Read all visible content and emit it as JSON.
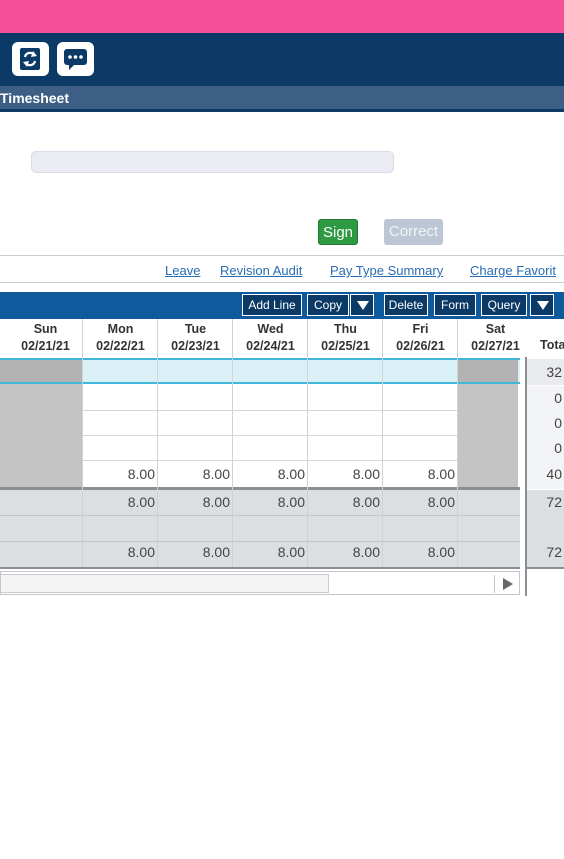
{
  "header": {
    "title": "Timesheet",
    "icons": [
      "refresh-icon",
      "chat-icon"
    ]
  },
  "actions": {
    "sign": "Sign",
    "correct": "Correct"
  },
  "links": [
    "Leave",
    "Revision Audit",
    "Pay Type Summary",
    "Charge Favorit"
  ],
  "toolbar": {
    "add_line": "Add Line",
    "copy": "Copy",
    "delete": "Delete",
    "form": "Form",
    "query": "Query"
  },
  "grid": {
    "days": [
      {
        "day": "Sun",
        "date": "02/21/21"
      },
      {
        "day": "Mon",
        "date": "02/22/21"
      },
      {
        "day": "Tue",
        "date": "02/23/21"
      },
      {
        "day": "Wed",
        "date": "02/24/21"
      },
      {
        "day": "Thu",
        "date": "02/25/21"
      },
      {
        "day": "Fri",
        "date": "02/26/21"
      },
      {
        "day": "Sat",
        "date": "02/27/21"
      }
    ],
    "total_label": "Tota",
    "rows": [
      {
        "values": [
          "",
          "",
          "",
          "",
          "",
          "",
          ""
        ],
        "total": "32"
      },
      {
        "values": [
          "",
          "",
          "",
          "",
          "",
          "",
          ""
        ],
        "total": "0"
      },
      {
        "values": [
          "",
          "",
          "",
          "",
          "",
          "",
          ""
        ],
        "total": "0"
      },
      {
        "values": [
          "",
          "",
          "",
          "",
          "",
          "",
          ""
        ],
        "total": "0"
      },
      {
        "values": [
          "",
          "8.00",
          "8.00",
          "8.00",
          "8.00",
          "8.00",
          ""
        ],
        "total": "40"
      }
    ],
    "summary_rows": [
      {
        "values": [
          "",
          "8.00",
          "8.00",
          "8.00",
          "8.00",
          "8.00",
          ""
        ],
        "total": "72"
      },
      {
        "values": [
          "",
          "",
          "",
          "",
          "",
          "",
          ""
        ],
        "total": ""
      },
      {
        "values": [
          "",
          "8.00",
          "8.00",
          "8.00",
          "8.00",
          "8.00",
          ""
        ],
        "total": "72"
      }
    ]
  },
  "colors": {
    "accent_pink": "#f54f9a",
    "navy": "#0b3a66",
    "sign_green": "#2e9a41",
    "selected_row": "#d9f0f7"
  }
}
